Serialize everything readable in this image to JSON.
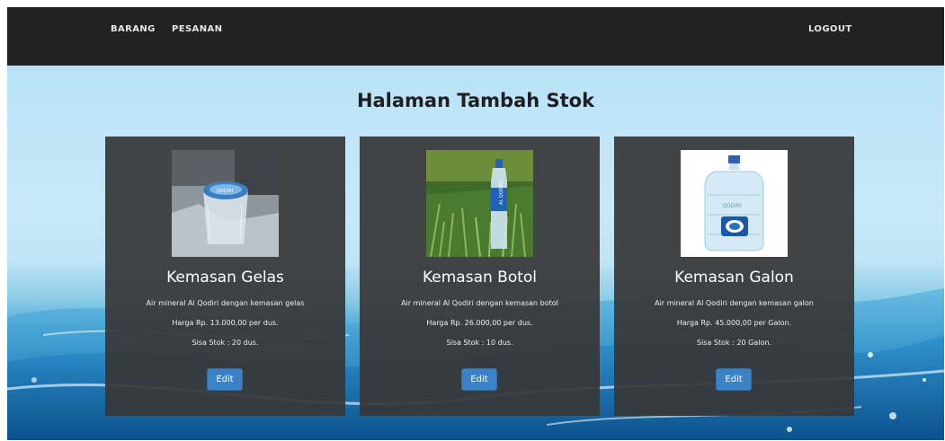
{
  "nav": {
    "barang": "BARANG",
    "pesanan": "PESANAN",
    "logout": "LOGOUT"
  },
  "page": {
    "title": "Halaman Tambah Stok"
  },
  "products": [
    {
      "image": "cup-water-product-image",
      "title": "Kemasan Gelas",
      "description": "Air mineral Al Qodiri dengan kemasan gelas",
      "price": "Harga Rp. 13.000,00 per dus.",
      "stock": "Sisa Stok : 20 dus.",
      "button": "Edit"
    },
    {
      "image": "bottle-water-product-image",
      "title": "Kemasan Botol",
      "description": "Air mineral Al Qodiri dengan kemasan botol",
      "price": "Harga Rp. 26.000,00 per dus.",
      "stock": "Sisa Stok : 10 dus.",
      "button": "Edit"
    },
    {
      "image": "gallon-water-product-image",
      "title": "Kemasan Galon",
      "description": "Air mineral Al Qodiri dengan kemasan galon",
      "price": "Harga Rp. 45.000,00 per Galon.",
      "stock": "Sisa Stok : 20 Galon.",
      "button": "Edit"
    }
  ],
  "colors": {
    "navbar": "#222222",
    "card": "#373737",
    "button": "#3c82c6",
    "title": "#1f1f1f"
  }
}
